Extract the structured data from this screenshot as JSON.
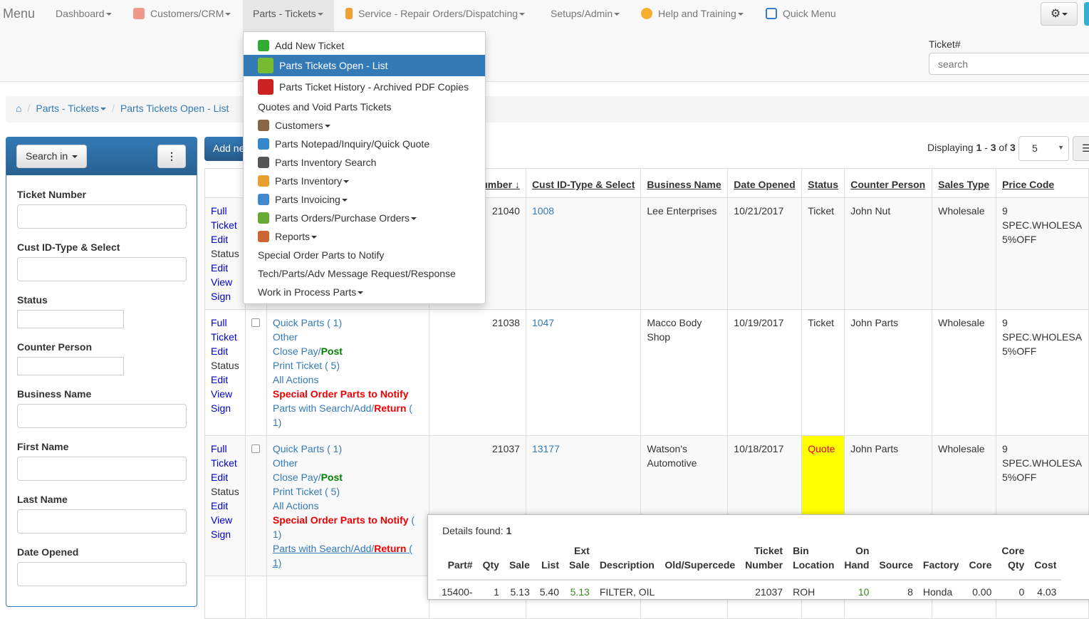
{
  "nav": {
    "menu": "Menu",
    "items": [
      "Dashboard",
      "Customers/CRM",
      "Parts - Tickets",
      "Service - Repair Orders/Dispatching",
      "Setups/Admin",
      "Help and Training",
      "Quick Menu"
    ],
    "ticket_label": "Ticket#",
    "ticket_placeholder": "search"
  },
  "breadcrumb": [
    "Parts - Tickets",
    "Parts Tickets Open - List"
  ],
  "dropdown": [
    "Add New Ticket",
    "Parts Tickets Open - List",
    "Parts Ticket History - Archived PDF Copies",
    "Quotes and Void Parts Tickets",
    "Customers",
    "Parts Notepad/Inquiry/Quick Quote",
    "Parts Inventory Search",
    "Parts Inventory",
    "Parts Invoicing",
    "Parts Orders/Purchase Orders",
    "Reports",
    "Special Order Parts to Notify",
    "Tech/Parts/Adv Message Request/Response",
    "Work in Process Parts"
  ],
  "sidebar": {
    "search_in": "Search in",
    "fields": [
      "Ticket Number",
      "Cust ID-Type & Select",
      "Status",
      "Counter Person",
      "Business Name",
      "First Name",
      "Last Name",
      "Date Opened"
    ]
  },
  "toolbar": {
    "add_new": "Add new",
    "displaying": "Displaying ",
    "from": "1",
    "dash": " - ",
    "to": "3",
    "of": " of ",
    "total": "3",
    "page_size": "5"
  },
  "table": {
    "headers": [
      "Ticket Number",
      "Cust ID-Type & Select",
      "Business Name",
      "Date Opened",
      "Status",
      "Counter Person",
      "Sales Type",
      "Price Code"
    ],
    "row_links": [
      "Full",
      "Ticket",
      "Edit",
      "Status",
      "Edit",
      "View",
      "Sign"
    ],
    "rows": [
      {
        "number": "21040",
        "cust": "1008",
        "business": "Lee Enterprises",
        "date": "10/21/2017",
        "status": "Ticket",
        "counter": "John Nut",
        "sales": "Wholesale",
        "price": [
          "9",
          "SPEC.WHOLESA",
          "5%OFF"
        ]
      },
      {
        "number": "21038",
        "cust": "1047",
        "business": "Macco Body Shop",
        "date": "10/19/2017",
        "status": "Ticket",
        "counter": "John Parts",
        "sales": "Wholesale",
        "price": [
          "9",
          "SPEC.WHOLESA",
          "5%OFF"
        ],
        "a_notify": "",
        "a_ret": " ( 1)"
      },
      {
        "number": "21037",
        "cust": "13177",
        "business": "Watson's Automotive",
        "date": "10/18/2017",
        "status": "Quote",
        "counter": "John Parts",
        "sales": "Wholesale",
        "price": [
          "9",
          "SPEC.WHOLESA",
          "5%OFF"
        ],
        "a_notify": " ( 1)",
        "a_ret": " ( 1)"
      }
    ],
    "actions": {
      "quick": "Quick Parts ( 1)",
      "other": "Other",
      "close": "Close Pay/",
      "post": "Post",
      "print": "Print Ticket ( 5)",
      "all": "All Actions",
      "notify": "Special Order Parts to Notify",
      "pws": "Parts with Search/Add/",
      "ret": "Return"
    }
  },
  "details": {
    "label": "Details found: ",
    "count": "1",
    "headers": [
      [
        "",
        "Part#"
      ],
      [
        "",
        "Qty"
      ],
      [
        "",
        "Sale"
      ],
      [
        "",
        "List"
      ],
      [
        "Ext",
        "Sale"
      ],
      [
        "",
        "Description"
      ],
      [
        "",
        "Old/Supercede"
      ],
      [
        "Ticket",
        "Number"
      ],
      [
        "Bin",
        "Location"
      ],
      [
        "On",
        "Hand"
      ],
      [
        "",
        "Source"
      ],
      [
        "",
        "Factory"
      ],
      [
        "",
        "Core"
      ],
      [
        "Core",
        "Qty"
      ],
      [
        "",
        "Cost"
      ]
    ],
    "row": [
      "15400-",
      "1",
      "5.13",
      "5.40",
      "5.13",
      "FILTER, OIL",
      "",
      "21037",
      "ROH",
      "10",
      "8",
      "Honda",
      "0.00",
      "0",
      "4.03"
    ]
  },
  "colors": {
    "primary": "#337ab7",
    "quote_bg": "#ffff00",
    "alert": "#ee0000"
  }
}
